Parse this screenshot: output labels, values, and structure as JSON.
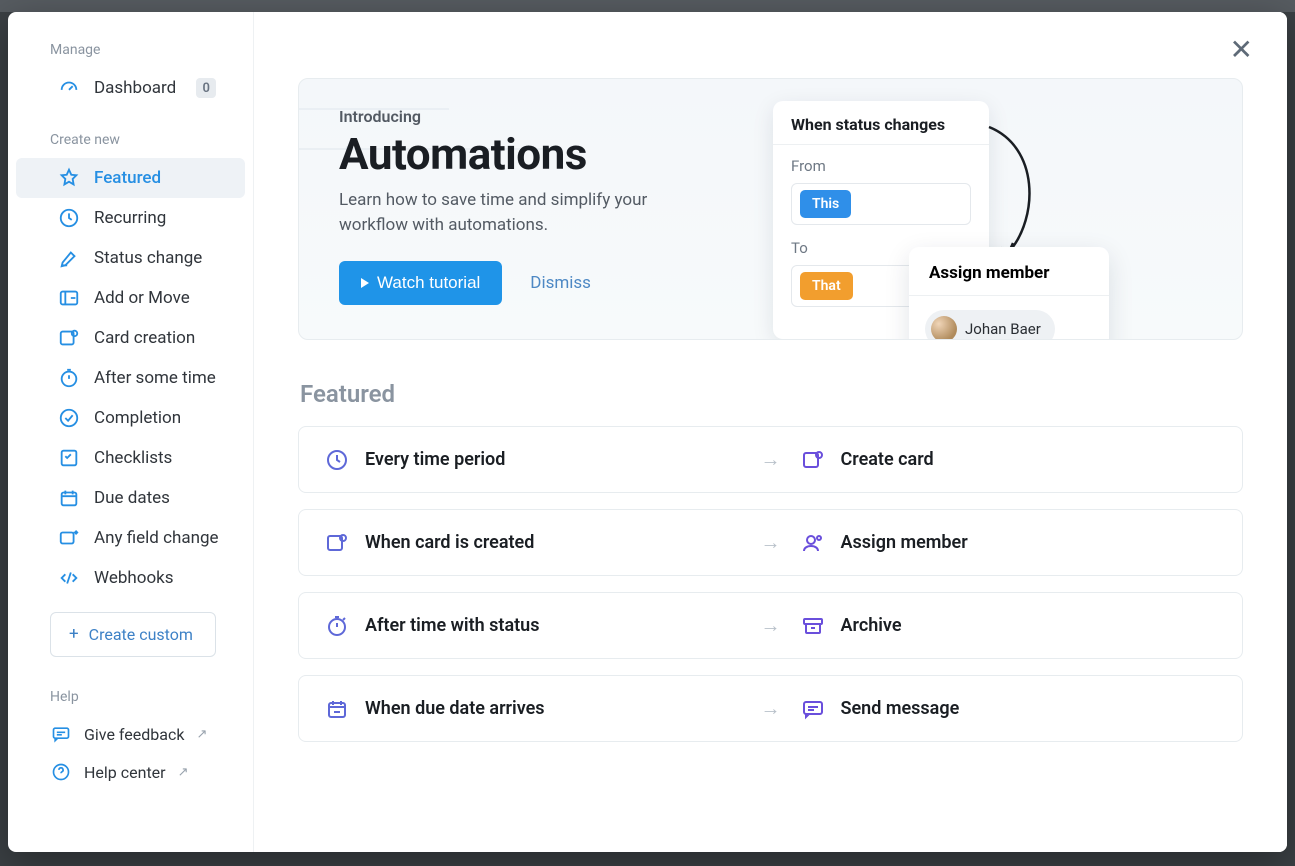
{
  "sidebar": {
    "manage_title": "Manage",
    "dashboard_label": "Dashboard",
    "dashboard_count": "0",
    "create_title": "Create new",
    "items": [
      {
        "label": "Featured"
      },
      {
        "label": "Recurring"
      },
      {
        "label": "Status change"
      },
      {
        "label": "Add or Move"
      },
      {
        "label": "Card creation"
      },
      {
        "label": "After some time"
      },
      {
        "label": "Completion"
      },
      {
        "label": "Checklists"
      },
      {
        "label": "Due dates"
      },
      {
        "label": "Any field change"
      },
      {
        "label": "Webhooks"
      }
    ],
    "create_custom": "Create custom",
    "help_title": "Help",
    "feedback": "Give feedback",
    "help_center": "Help center"
  },
  "intro": {
    "kicker": "Introducing",
    "title": "Automations",
    "desc": "Learn how to save time and simplify your workflow with automations.",
    "watch": "Watch tutorial",
    "dismiss": "Dismiss",
    "when_title": "When status changes",
    "from_label": "From",
    "to_label": "To",
    "chip_this": "This",
    "chip_that": "That",
    "assign_title": "Assign member",
    "member_name": "Johan Baer"
  },
  "featured": {
    "title": "Featured",
    "items": [
      {
        "trigger": "Every time period",
        "action": "Create card",
        "tcolor": "#5e68d8",
        "acolor": "#6a4fdc"
      },
      {
        "trigger": "When card is created",
        "action": "Assign member",
        "tcolor": "#5e68d8",
        "acolor": "#6a4fdc"
      },
      {
        "trigger": "After time with status",
        "action": "Archive",
        "tcolor": "#5e68d8",
        "acolor": "#6a4fdc"
      },
      {
        "trigger": "When due date arrives",
        "action": "Send message",
        "tcolor": "#5e68d8",
        "acolor": "#6a4fdc"
      }
    ]
  }
}
